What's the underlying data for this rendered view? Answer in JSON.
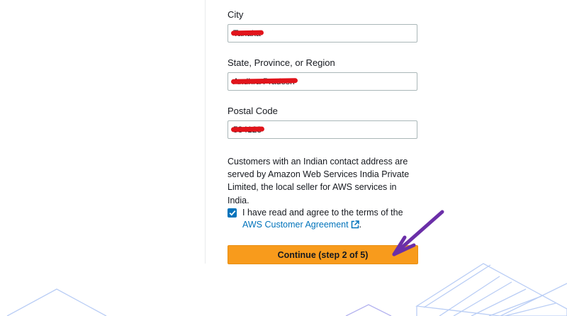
{
  "form": {
    "city": {
      "label": "City",
      "value": "Tanaka"
    },
    "state": {
      "label": "State, Province, or Region",
      "value": "Andhra Pradesh"
    },
    "postal": {
      "label": "Postal Code",
      "value": "534123"
    }
  },
  "notice_text": "Customers with an Indian contact address are served by Amazon Web Services India Private Limited, the local seller for AWS services in India.",
  "agreement": {
    "checked": true,
    "text": "I have read and agree to the terms of the",
    "link_text": "AWS Customer Agreement",
    "suffix": "."
  },
  "continue_button_label": "Continue (step 2 of 5)",
  "colors": {
    "button": "#f89b1c",
    "link": "#0073bb",
    "annotation_arrow": "#6b2fa8",
    "redaction": "#e1141b"
  }
}
